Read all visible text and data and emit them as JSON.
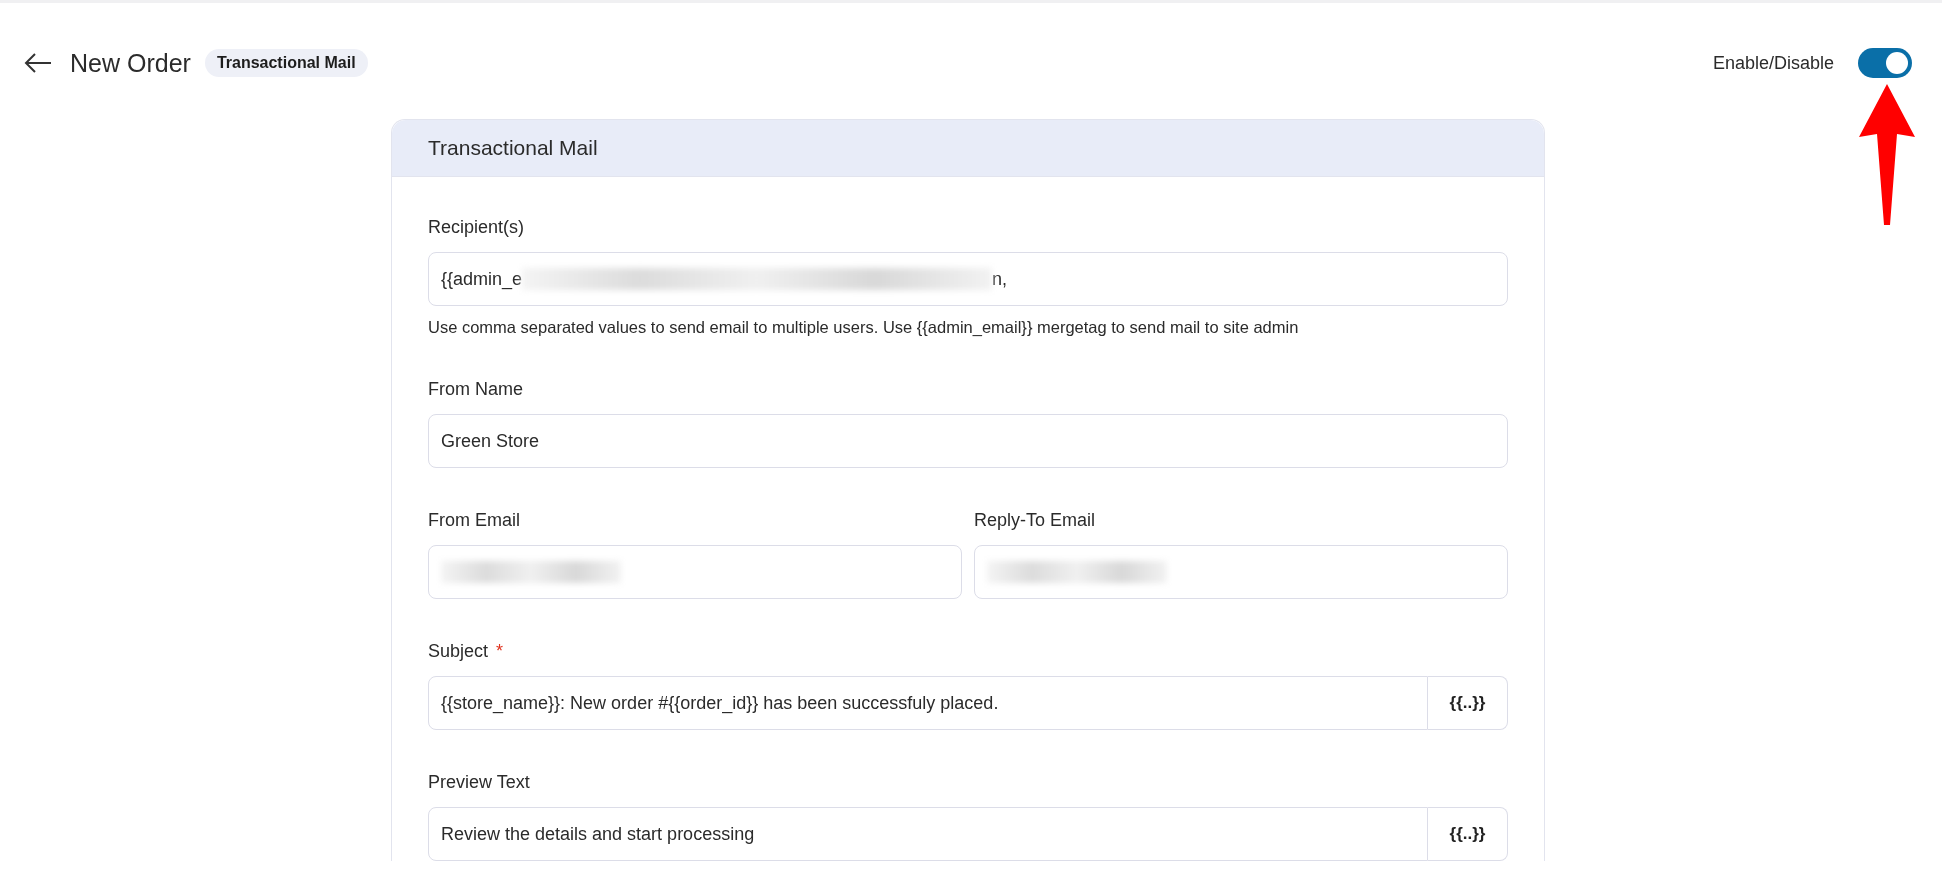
{
  "header": {
    "title": "New Order",
    "badge": "Transactional Mail",
    "toggle_label": "Enable/Disable",
    "enabled": true
  },
  "card": {
    "title": "Transactional Mail",
    "fields": [
      {
        "kind": "text",
        "label": "Recipient(s)",
        "value_start": "{{admin_e",
        "value_end": "n,",
        "redacted": true,
        "help": "Use comma separated values to send email to multiple users. Use {{admin_email}} mergetag to send mail to site admin"
      },
      {
        "kind": "text",
        "label": "From Name",
        "value_start": "Green Store"
      },
      {
        "kind": "pair",
        "items": [
          {
            "label": "From Email",
            "redacted": true
          },
          {
            "label": "Reply-To Email",
            "redacted": true
          }
        ]
      },
      {
        "kind": "mergetag",
        "label": "Subject",
        "required_mark": "*",
        "value_start": "{{store_name}}: New order #{{order_id}} has been successfuly placed.",
        "button": "{{..}}"
      },
      {
        "kind": "mergetag",
        "label": "Preview Text",
        "value_start": "Review the details and start processing",
        "button": "{{..}}"
      }
    ]
  }
}
